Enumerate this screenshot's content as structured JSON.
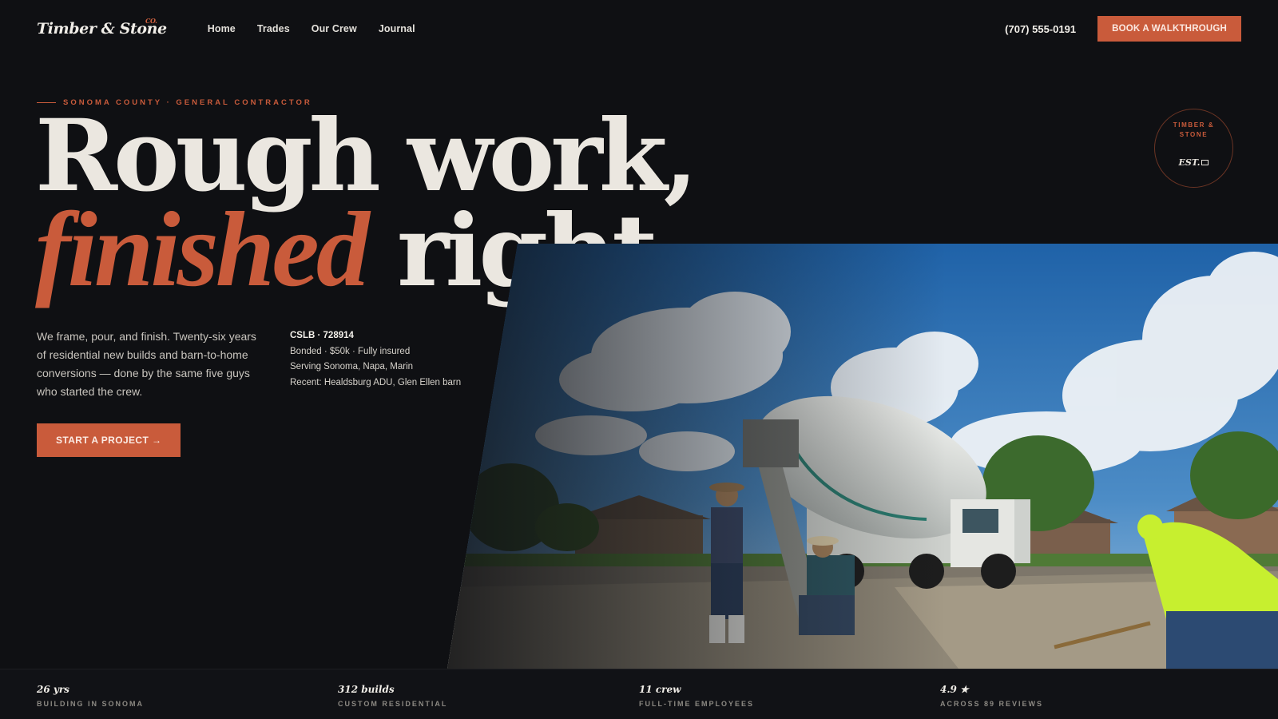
{
  "nav": {
    "brand": "Timber & Stone",
    "brand_sup": "CO.",
    "links": [
      "Home",
      "Trades",
      "Our Crew",
      "Journal"
    ],
    "phone": "(707) 555-0191",
    "cta": "BOOK A WALKTHROUGH"
  },
  "hero": {
    "eyebrow": "SONOMA COUNTY · GENERAL CONTRACTOR",
    "headline_line1": "Rough work,",
    "headline_accent": "finished",
    "headline_rest": "right.",
    "intro": "We frame, pour, and finish. Twenty-six years of residential new builds and barn-to-home conversions — done by the same five guys who started the crew.",
    "facts": {
      "license": "CSLB · 728914",
      "bonded": "Bonded · $50k · Fully insured",
      "serving": "Serving Sonoma, Napa, Marin",
      "recent": "Recent: Healdsburg ADU, Glen Ellen barn"
    },
    "cta": "START A PROJECT →"
  },
  "stamp": {
    "text": "TIMBER & STONE",
    "est": "EST."
  },
  "stats": [
    {
      "value": "26 yrs",
      "label": "BUILDING IN SONOMA"
    },
    {
      "value": "312 builds",
      "label": "CUSTOM RESIDENTIAL"
    },
    {
      "value": "11 crew",
      "label": "FULL-TIME EMPLOYEES"
    },
    {
      "value": "4.9 ★",
      "label": "ACROSS 89 REVIEWS"
    }
  ],
  "colors": {
    "accent": "#c95b3b",
    "background": "#0f1013",
    "text": "#ece9e3"
  }
}
